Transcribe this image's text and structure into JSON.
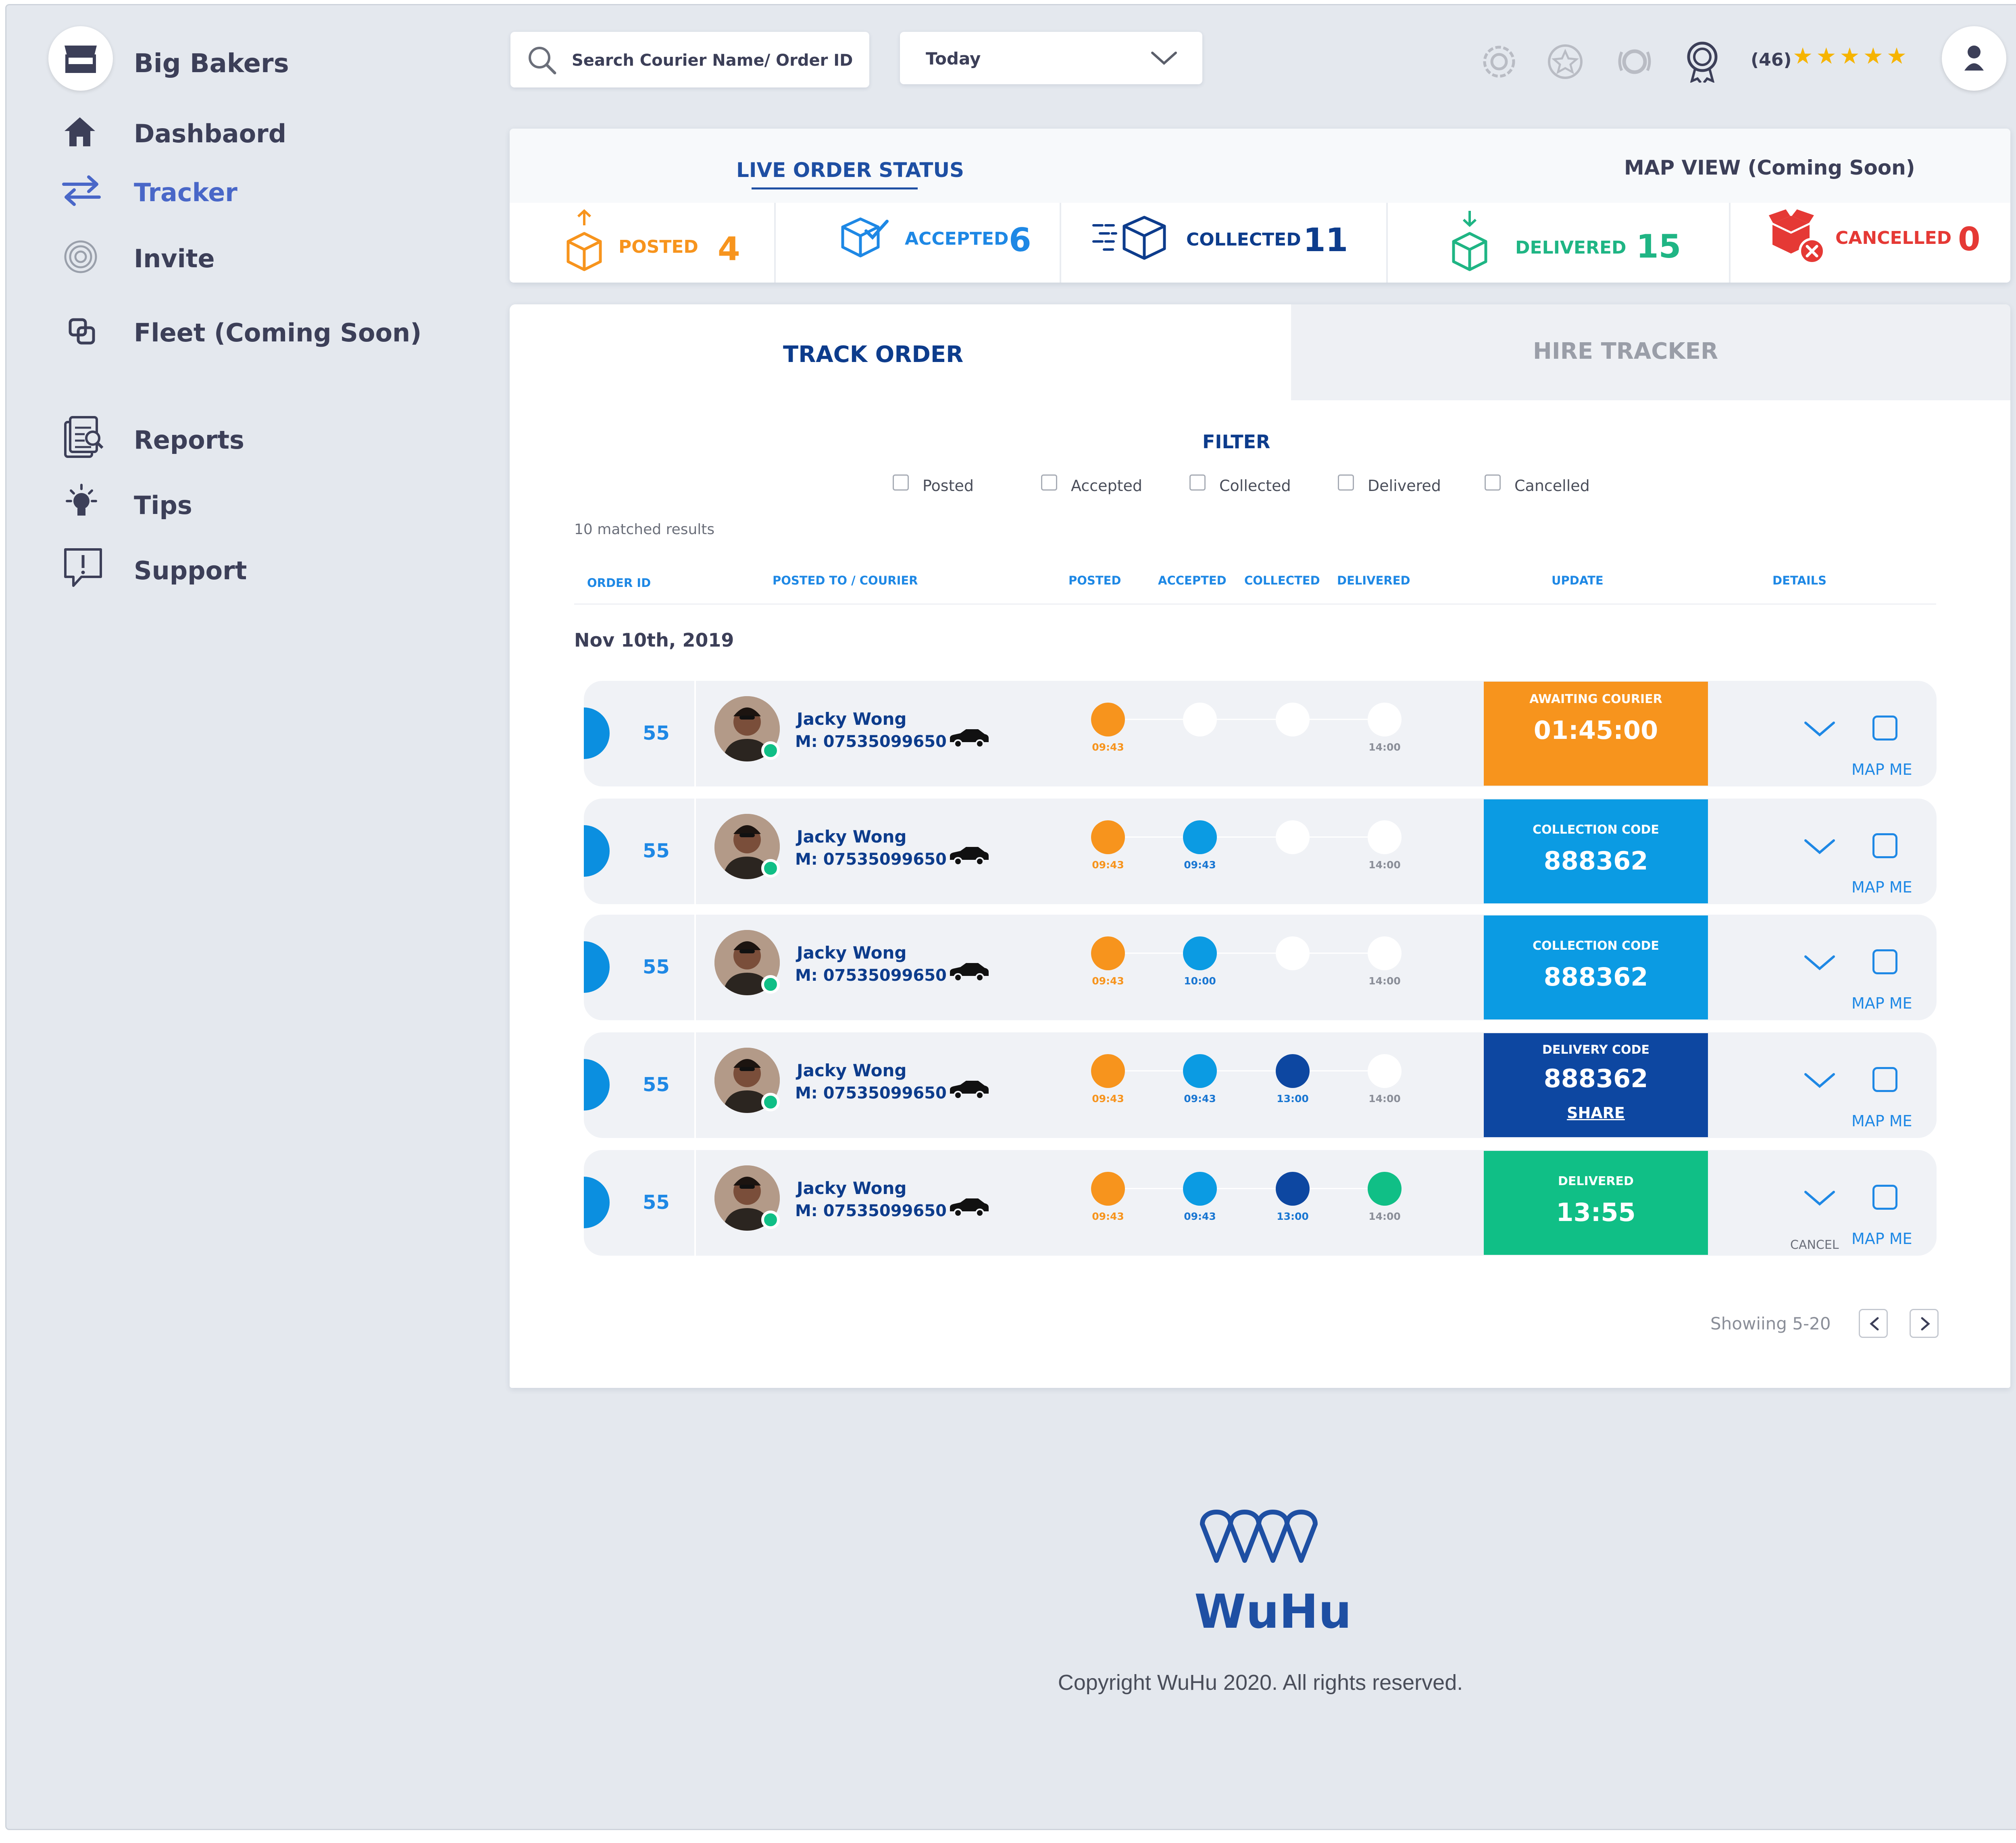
{
  "brand": {
    "name": "Big Bakers"
  },
  "sidebar": {
    "items": [
      {
        "label": "Dashbaord",
        "icon": "home-icon"
      },
      {
        "label": "Tracker",
        "icon": "swap-arrows-icon"
      },
      {
        "label": "Invite",
        "icon": "target-icon"
      },
      {
        "label": "Fleet (Coming Soon)",
        "icon": "fleet-icon"
      },
      {
        "label": "Reports",
        "icon": "reports-icon"
      },
      {
        "label": "Tips",
        "icon": "lightbulb-icon"
      },
      {
        "label": "Support",
        "icon": "support-icon"
      }
    ]
  },
  "topbar": {
    "search_placeholder": "Search Courier Name/  Order ID",
    "date_filter": "Today",
    "rating_count": "(46)",
    "stars": 5
  },
  "status": {
    "tab_live": "LIVE ORDER STATUS",
    "tab_map": "MAP VIEW (Coming Soon)",
    "items": [
      {
        "label": "POSTED",
        "count": "4",
        "color": "#f7941d"
      },
      {
        "label": "ACCEPTED",
        "count": "6",
        "color": "#1e88e5"
      },
      {
        "label": "COLLECTED",
        "count": "11",
        "color": "#0d3c8c"
      },
      {
        "label": "DELIVERED",
        "count": "15",
        "color": "#1fb584"
      },
      {
        "label": "CANCELLED",
        "count": "0",
        "color": "#e53935"
      }
    ]
  },
  "tabs": {
    "track": "TRACK ORDER",
    "hire": "HIRE TRACKER"
  },
  "filter": {
    "title": "FILTER",
    "options": [
      "Posted",
      "Accepted",
      "Collected",
      "Delivered",
      "Cancelled"
    ]
  },
  "results": "10 matched results",
  "columns": {
    "order_id": "ORDER ID",
    "courier": "POSTED TO / COURIER",
    "posted": "POSTED",
    "accepted": "ACCEPTED",
    "collected": "COLLECTED",
    "delivered": "DELIVERED",
    "update": "UPDATE",
    "details": "DETAILS"
  },
  "date": "Nov 10th, 2019",
  "rows": [
    {
      "id": "55",
      "name": "Jacky Wong",
      "phone": "M: 07535099650",
      "t1": "09:43",
      "t2": "",
      "t3": "",
      "t4": "14:00",
      "status_label": "AWAITING COURIER",
      "status_value": "01:45:00",
      "status_extra": "",
      "map": "MAP ME",
      "cancel": ""
    },
    {
      "id": "55",
      "name": "Jacky Wong",
      "phone": "M: 07535099650",
      "t1": "09:43",
      "t2": "09:43",
      "t3": "",
      "t4": "14:00",
      "status_label": "COLLECTION CODE",
      "status_value": "888362",
      "status_extra": "",
      "map": "MAP ME",
      "cancel": ""
    },
    {
      "id": "55",
      "name": "Jacky Wong",
      "phone": "M: 07535099650",
      "t1": "09:43",
      "t2": "10:00",
      "t3": "",
      "t4": "14:00",
      "status_label": "COLLECTION CODE",
      "status_value": "888362",
      "status_extra": "",
      "map": "MAP ME",
      "cancel": ""
    },
    {
      "id": "55",
      "name": "Jacky Wong",
      "phone": "M: 07535099650",
      "t1": "09:43",
      "t2": "09:43",
      "t3": "13:00",
      "t4": "14:00",
      "status_label": "DELIVERY CODE",
      "status_value": "888362",
      "status_extra": "SHARE",
      "map": "MAP ME",
      "cancel": ""
    },
    {
      "id": "55",
      "name": "Jacky Wong",
      "phone": "M: 07535099650",
      "t1": "09:43",
      "t2": "09:43",
      "t3": "13:00",
      "t4": "14:00",
      "status_label": "DELIVERED",
      "status_value": "13:55",
      "status_extra": "",
      "map": "MAP ME",
      "cancel": "CANCEL"
    }
  ],
  "pagination": {
    "label": "Showiing 5-20"
  },
  "footer": {
    "logo": "WuHu",
    "copyright": "Copyright WuHu 2020. All rights reserved."
  },
  "colors": {
    "orange": "#f7941d",
    "blue": "#0b9be3",
    "navy": "#0d47a1",
    "green": "#10bf86",
    "accent": "#1e4fa3"
  }
}
